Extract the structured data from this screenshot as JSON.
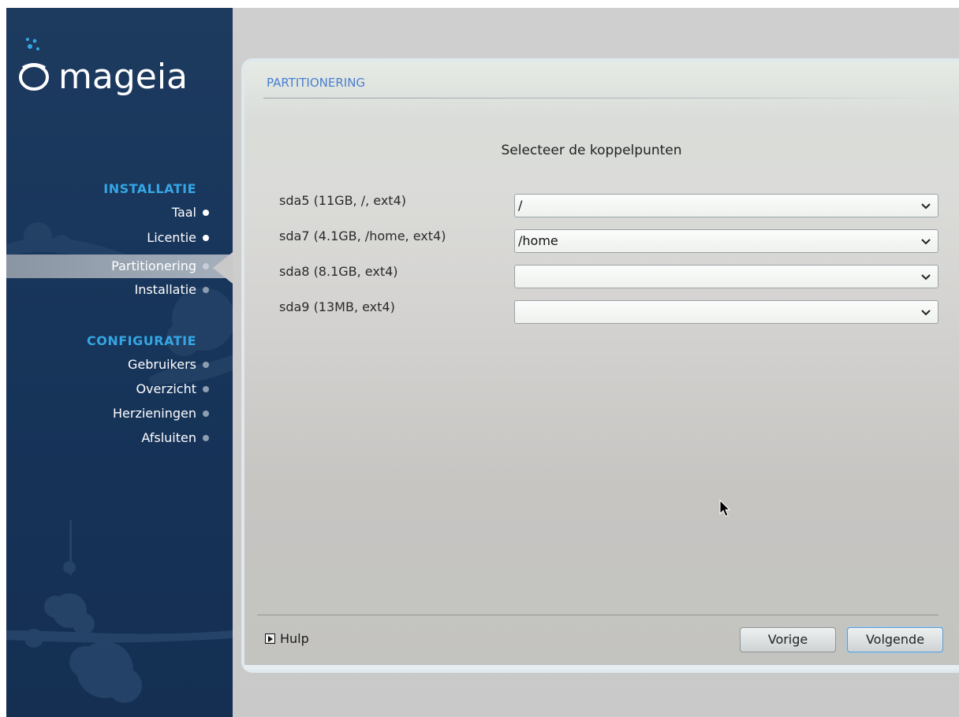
{
  "brand": {
    "logo_text": "mageia"
  },
  "sidebar": {
    "sections": [
      {
        "title": "INSTALLATIE",
        "items": [
          {
            "label": "Taal",
            "state": "done"
          },
          {
            "label": "Licentie",
            "state": "done"
          },
          {
            "label": "Partitionering",
            "state": "active"
          },
          {
            "label": "Installatie",
            "state": "pending"
          }
        ]
      },
      {
        "title": "CONFIGURATIE",
        "items": [
          {
            "label": "Gebruikers",
            "state": "pending"
          },
          {
            "label": "Overzicht",
            "state": "pending"
          },
          {
            "label": "Herzieningen",
            "state": "pending"
          },
          {
            "label": "Afsluiten",
            "state": "pending"
          }
        ]
      }
    ]
  },
  "main": {
    "title": "PARTITIONERING",
    "subtitle": "Selecteer de koppelpunten",
    "partitions": [
      {
        "label": "sda5 (11GB, /, ext4)",
        "value": "/"
      },
      {
        "label": "sda7 (4.1GB, /home, ext4)",
        "value": "/home"
      },
      {
        "label": "sda8 (8.1GB, ext4)",
        "value": ""
      },
      {
        "label": "sda9 (13MB, ext4)",
        "value": ""
      }
    ],
    "help_label": "Hulp",
    "prev_label": "Vorige",
    "next_label": "Volgende"
  },
  "colors": {
    "sidebar_bg": "#17345a",
    "section_title": "#35a6e4",
    "panel_title": "#4a7fcf",
    "focus_border": "#5b9bd0"
  }
}
